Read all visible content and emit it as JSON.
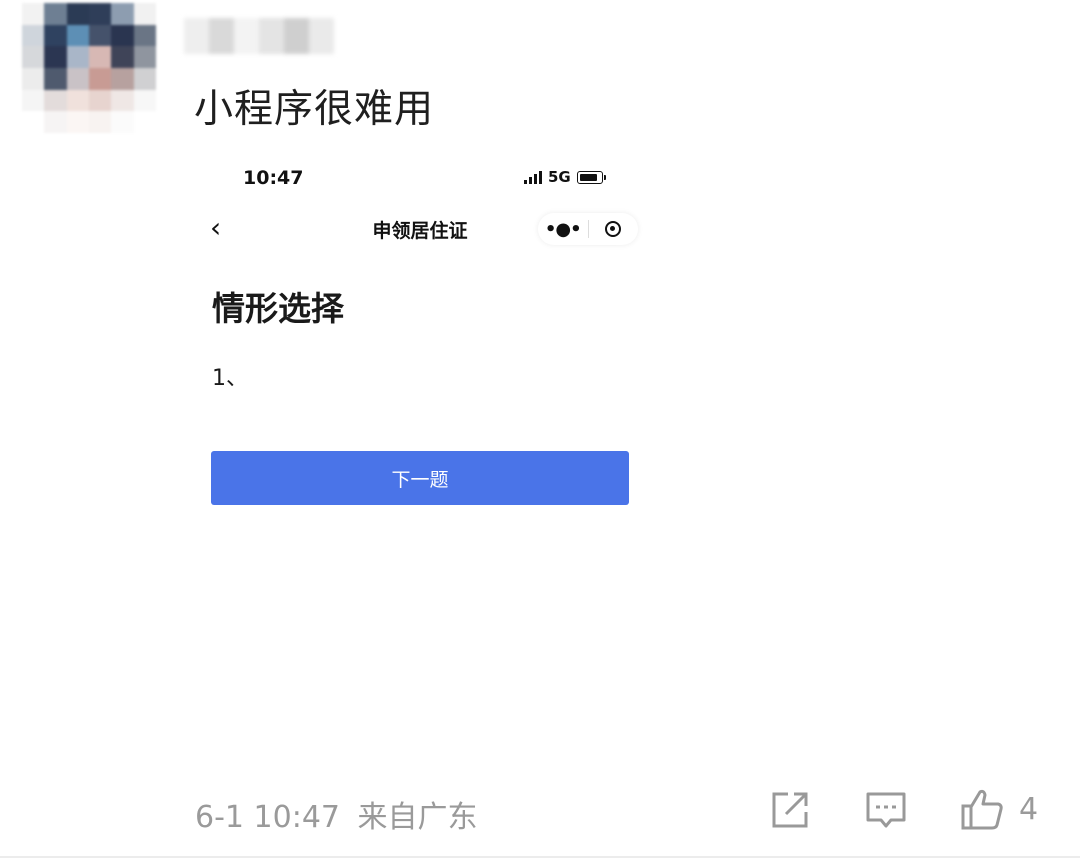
{
  "post": {
    "text": "小程序很难用",
    "time": "6-1 10:47",
    "location": "来自广东",
    "like_count": "4"
  },
  "avatar_colors": [
    "#f2f2f2",
    "#6e7f93",
    "#2b3b55",
    "#2f3e59",
    "#8d9db0",
    "#f1f1f1",
    "#cfd5dc",
    "#2f4260",
    "#5d8fb5",
    "#45526b",
    "#2a3550",
    "#6a7585",
    "#d6d8db",
    "#2b3652",
    "#a9b6c8",
    "#d7b8b4",
    "#3f4458",
    "#8f959f",
    "#ececec",
    "#4f5a6e",
    "#c9c2c6",
    "#c89b94",
    "#b7a19f",
    "#d0d0d2",
    "#f5f5f5",
    "#e3dcdb",
    "#f0e1dc",
    "#e7d4cf",
    "#efe7e5",
    "#f7f7f7",
    "#ffffff",
    "#f6f4f4",
    "#fbf6f4",
    "#f8f3f1",
    "#fbfbfb",
    "#ffffff"
  ],
  "username_colors": [
    "#eeeeee",
    "#d9d9d9",
    "#f3f3f3",
    "#e4e4e4",
    "#cfcfcf",
    "#eaeaea"
  ],
  "screenshot": {
    "status_time": "10:47",
    "network": "5G",
    "nav_title": "申领居住证",
    "heading": "情形选择",
    "question": "1、",
    "next_button": "下一题"
  },
  "icons": {
    "share": "share-icon",
    "comment": "comment-icon",
    "like": "thumbs-up-icon",
    "back": "chevron-left-icon",
    "more": "more-dots-icon",
    "close": "target-circle-icon"
  }
}
